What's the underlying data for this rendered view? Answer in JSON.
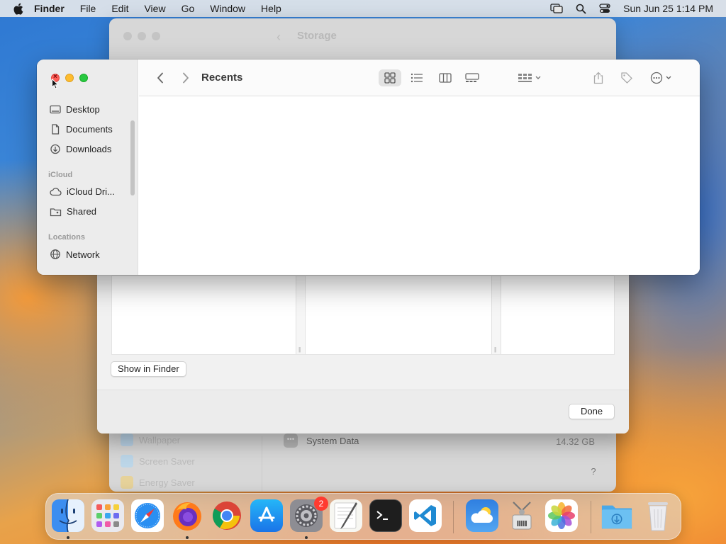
{
  "menubar": {
    "app_name": "Finder",
    "menus": [
      "File",
      "Edit",
      "View",
      "Go",
      "Window",
      "Help"
    ],
    "clock": "Sun Jun 25  1:14 PM"
  },
  "storage_window": {
    "title": "Storage",
    "sidebar_items": [
      "Wallpaper",
      "Screen Saver",
      "Energy Saver"
    ],
    "system_data_label": "System Data",
    "system_data_size": "14.32 GB",
    "help_label": "?"
  },
  "sheet": {
    "show_in_finder": "Show in Finder",
    "done": "Done"
  },
  "finder": {
    "title": "Recents",
    "sidebar": {
      "favorites": [
        "Desktop",
        "Documents",
        "Downloads"
      ],
      "icloud_header": "iCloud",
      "icloud": [
        "iCloud Dri...",
        "Shared"
      ],
      "locations_header": "Locations",
      "locations": [
        "Network"
      ]
    },
    "toolbar_icons": [
      "back-icon",
      "forward-icon",
      "icon-view-icon",
      "list-view-icon",
      "column-view-icon",
      "gallery-view-icon",
      "group-icon",
      "share-icon",
      "tag-icon",
      "more-icon",
      "search-icon"
    ],
    "selected_view": "icon-view"
  },
  "dock": {
    "apps": [
      "Finder",
      "Launchpad",
      "Safari",
      "Firefox",
      "Chrome",
      "App Store",
      "System Settings",
      "TextEdit",
      "Terminal",
      "Visual Studio Code",
      "Weather",
      "Archive Utility",
      "Photos",
      "Downloads",
      "Trash"
    ],
    "system_settings_badge": "2"
  }
}
